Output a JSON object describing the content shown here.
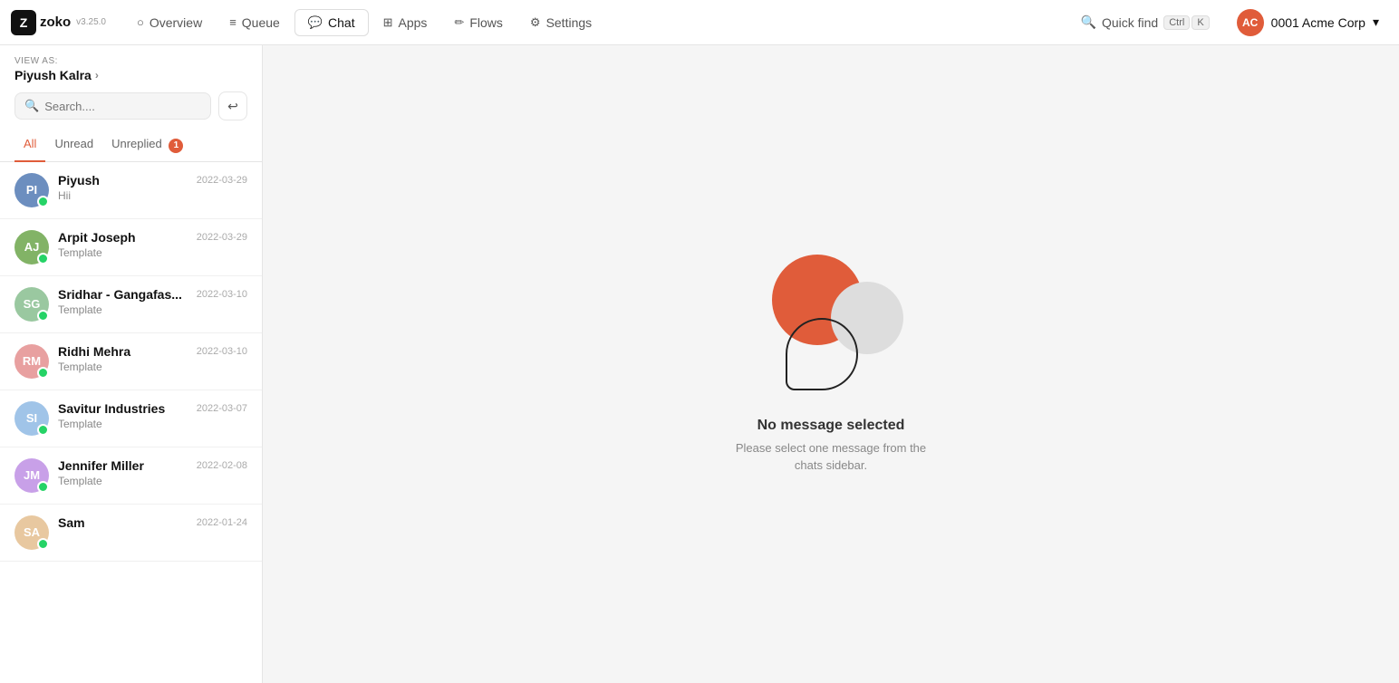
{
  "app": {
    "logo_text": "zoko",
    "logo_version": "v3.25.0",
    "logo_icon": "Z"
  },
  "nav": {
    "items": [
      {
        "id": "overview",
        "label": "Overview",
        "icon": "○",
        "active": false
      },
      {
        "id": "queue",
        "label": "Queue",
        "icon": "≡",
        "active": false
      },
      {
        "id": "chat",
        "label": "Chat",
        "icon": "💬",
        "active": true
      },
      {
        "id": "apps",
        "label": "Apps",
        "icon": "⊞",
        "active": false
      },
      {
        "id": "flows",
        "label": "Flows",
        "icon": "✏",
        "active": false
      },
      {
        "id": "settings",
        "label": "Settings",
        "icon": "⚙",
        "active": false
      }
    ],
    "quick_find_label": "Quick find",
    "ctrl_label": "Ctrl",
    "k_label": "K",
    "account_name": "0001 Acme Corp",
    "account_initials": "AC"
  },
  "sidebar": {
    "view_as_label": "VIEW AS:",
    "view_as_user": "Piyush Kalra",
    "search_placeholder": "Search....",
    "compose_icon": "↩",
    "tabs": [
      {
        "id": "all",
        "label": "All",
        "active": true,
        "badge": null
      },
      {
        "id": "unread",
        "label": "Unread",
        "active": false,
        "badge": null
      },
      {
        "id": "unreplied",
        "label": "Unreplied",
        "active": false,
        "badge": 1
      }
    ],
    "chats": [
      {
        "id": "piyush",
        "name": "Piyush",
        "initials": "PI",
        "color": "#6c8ebf",
        "date": "2022-03-29",
        "preview": "Hii",
        "has_wa": true
      },
      {
        "id": "arpit-joseph",
        "name": "Arpit Joseph",
        "initials": "AJ",
        "color": "#82b366",
        "date": "2022-03-29",
        "preview": "Template",
        "has_wa": true
      },
      {
        "id": "sridhar",
        "name": "Sridhar - Gangafas...",
        "initials": "SG",
        "color": "#9ac8a0",
        "date": "2022-03-10",
        "preview": "Template",
        "has_wa": true
      },
      {
        "id": "ridhi-mehra",
        "name": "Ridhi Mehra",
        "initials": "RM",
        "color": "#e8a0a0",
        "date": "2022-03-10",
        "preview": "Template",
        "has_wa": true
      },
      {
        "id": "savitur-industries",
        "name": "Savitur Industries",
        "initials": "SI",
        "color": "#a0c4e8",
        "date": "2022-03-07",
        "preview": "Template",
        "has_wa": true
      },
      {
        "id": "jennifer-miller",
        "name": "Jennifer Miller",
        "initials": "JM",
        "color": "#c8a0e8",
        "date": "2022-02-08",
        "preview": "Template",
        "has_wa": true
      },
      {
        "id": "sam",
        "name": "Sam",
        "initials": "SA",
        "color": "#e8c8a0",
        "date": "2022-01-24",
        "preview": "",
        "has_wa": true
      }
    ]
  },
  "empty_state": {
    "title": "No message selected",
    "subtitle": "Please select one message from the\nchats sidebar."
  }
}
